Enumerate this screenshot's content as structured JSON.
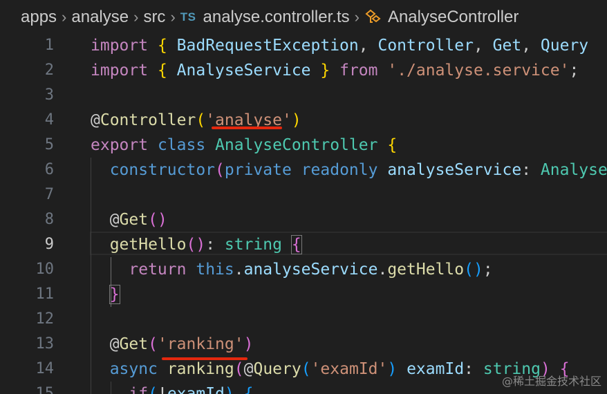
{
  "breadcrumb": {
    "segments": [
      "apps",
      "analyse",
      "src"
    ],
    "file_badge": "TS",
    "file_name": "analyse.controller.ts",
    "symbol": "AnalyseController"
  },
  "editor": {
    "active_line": 9,
    "lines": [
      {
        "num": "1",
        "tokens": [
          {
            "t": "import",
            "c": "kw"
          },
          {
            "t": " ",
            "c": "pn"
          },
          {
            "t": "{",
            "c": "b1"
          },
          {
            "t": " BadRequestException",
            "c": "var"
          },
          {
            "t": ", ",
            "c": "pn"
          },
          {
            "t": "Controller",
            "c": "var"
          },
          {
            "t": ", ",
            "c": "pn"
          },
          {
            "t": "Get",
            "c": "var"
          },
          {
            "t": ", ",
            "c": "pn"
          },
          {
            "t": "Query",
            "c": "var"
          }
        ]
      },
      {
        "num": "2",
        "tokens": [
          {
            "t": "import",
            "c": "kw"
          },
          {
            "t": " ",
            "c": "pn"
          },
          {
            "t": "{",
            "c": "b1"
          },
          {
            "t": " AnalyseService ",
            "c": "var"
          },
          {
            "t": "}",
            "c": "b1"
          },
          {
            "t": " ",
            "c": "pn"
          },
          {
            "t": "from",
            "c": "kw"
          },
          {
            "t": " ",
            "c": "pn"
          },
          {
            "t": "'./analyse.service'",
            "c": "str"
          },
          {
            "t": ";",
            "c": "pn"
          }
        ]
      },
      {
        "num": "3",
        "tokens": []
      },
      {
        "num": "4",
        "tokens": [
          {
            "t": "@",
            "c": "pn"
          },
          {
            "t": "Controller",
            "c": "fn"
          },
          {
            "t": "(",
            "c": "b1"
          },
          {
            "t": "'analyse'",
            "c": "str"
          },
          {
            "t": ")",
            "c": "b1"
          }
        ]
      },
      {
        "num": "5",
        "tokens": [
          {
            "t": "export",
            "c": "kw"
          },
          {
            "t": " ",
            "c": "pn"
          },
          {
            "t": "class",
            "c": "bl"
          },
          {
            "t": " ",
            "c": "pn"
          },
          {
            "t": "AnalyseController",
            "c": "ty"
          },
          {
            "t": " ",
            "c": "pn"
          },
          {
            "t": "{",
            "c": "b1"
          }
        ]
      },
      {
        "num": "6",
        "tokens": [
          {
            "t": "  ",
            "c": "pn"
          },
          {
            "t": "constructor",
            "c": "bl"
          },
          {
            "t": "(",
            "c": "b2"
          },
          {
            "t": "private",
            "c": "bl"
          },
          {
            "t": " ",
            "c": "pn"
          },
          {
            "t": "readonly",
            "c": "bl"
          },
          {
            "t": " ",
            "c": "pn"
          },
          {
            "t": "analyseService",
            "c": "var"
          },
          {
            "t": ": ",
            "c": "pn"
          },
          {
            "t": "AnalyseService",
            "c": "ty"
          }
        ]
      },
      {
        "num": "7",
        "tokens": []
      },
      {
        "num": "8",
        "tokens": [
          {
            "t": "  @",
            "c": "pn"
          },
          {
            "t": "Get",
            "c": "fn"
          },
          {
            "t": "()",
            "c": "b2"
          }
        ]
      },
      {
        "num": "9",
        "tokens": [
          {
            "t": "  ",
            "c": "pn"
          },
          {
            "t": "getHello",
            "c": "fn"
          },
          {
            "t": "()",
            "c": "b2"
          },
          {
            "t": ": ",
            "c": "pn"
          },
          {
            "t": "string",
            "c": "ty"
          },
          {
            "t": " ",
            "c": "pn"
          },
          {
            "t": "{",
            "c": "b2",
            "m": true
          }
        ]
      },
      {
        "num": "10",
        "tokens": [
          {
            "t": "    ",
            "c": "pn"
          },
          {
            "t": "return",
            "c": "kw"
          },
          {
            "t": " ",
            "c": "pn"
          },
          {
            "t": "this",
            "c": "bl"
          },
          {
            "t": ".",
            "c": "pn"
          },
          {
            "t": "analyseService",
            "c": "var"
          },
          {
            "t": ".",
            "c": "pn"
          },
          {
            "t": "getHello",
            "c": "fn"
          },
          {
            "t": "()",
            "c": "b3"
          },
          {
            "t": ";",
            "c": "pn"
          }
        ]
      },
      {
        "num": "11",
        "tokens": [
          {
            "t": "  ",
            "c": "pn"
          },
          {
            "t": "}",
            "c": "b2",
            "m": true
          }
        ]
      },
      {
        "num": "12",
        "tokens": []
      },
      {
        "num": "13",
        "tokens": [
          {
            "t": "  @",
            "c": "pn"
          },
          {
            "t": "Get",
            "c": "fn"
          },
          {
            "t": "(",
            "c": "b2"
          },
          {
            "t": "'ranking'",
            "c": "str"
          },
          {
            "t": ")",
            "c": "b2"
          }
        ]
      },
      {
        "num": "14",
        "tokens": [
          {
            "t": "  ",
            "c": "pn"
          },
          {
            "t": "async",
            "c": "bl"
          },
          {
            "t": " ",
            "c": "pn"
          },
          {
            "t": "ranking",
            "c": "fn"
          },
          {
            "t": "(",
            "c": "b2"
          },
          {
            "t": "@",
            "c": "pn"
          },
          {
            "t": "Query",
            "c": "fn"
          },
          {
            "t": "(",
            "c": "b3"
          },
          {
            "t": "'examId'",
            "c": "str"
          },
          {
            "t": ")",
            "c": "b3"
          },
          {
            "t": " ",
            "c": "pn"
          },
          {
            "t": "examId",
            "c": "var"
          },
          {
            "t": ": ",
            "c": "pn"
          },
          {
            "t": "string",
            "c": "ty"
          },
          {
            "t": ")",
            "c": "b2"
          },
          {
            "t": " ",
            "c": "pn"
          },
          {
            "t": "{",
            "c": "b2"
          }
        ]
      },
      {
        "num": "15",
        "tokens": [
          {
            "t": "    ",
            "c": "pn"
          },
          {
            "t": "if",
            "c": "kw"
          },
          {
            "t": "(",
            "c": "b3"
          },
          {
            "t": "!",
            "c": "pn"
          },
          {
            "t": "examId",
            "c": "var"
          },
          {
            "t": ")",
            "c": "b3"
          },
          {
            "t": " ",
            "c": "pn"
          },
          {
            "t": "{",
            "c": "b3"
          }
        ]
      }
    ]
  },
  "watermark": "@稀土掘金技术社区",
  "colors": {
    "background": "#1f1f1f",
    "underline": "#e4280e",
    "keyword": "#c586c0",
    "string": "#ce9178",
    "type": "#4ec9b0",
    "function": "#dcdcaa"
  }
}
